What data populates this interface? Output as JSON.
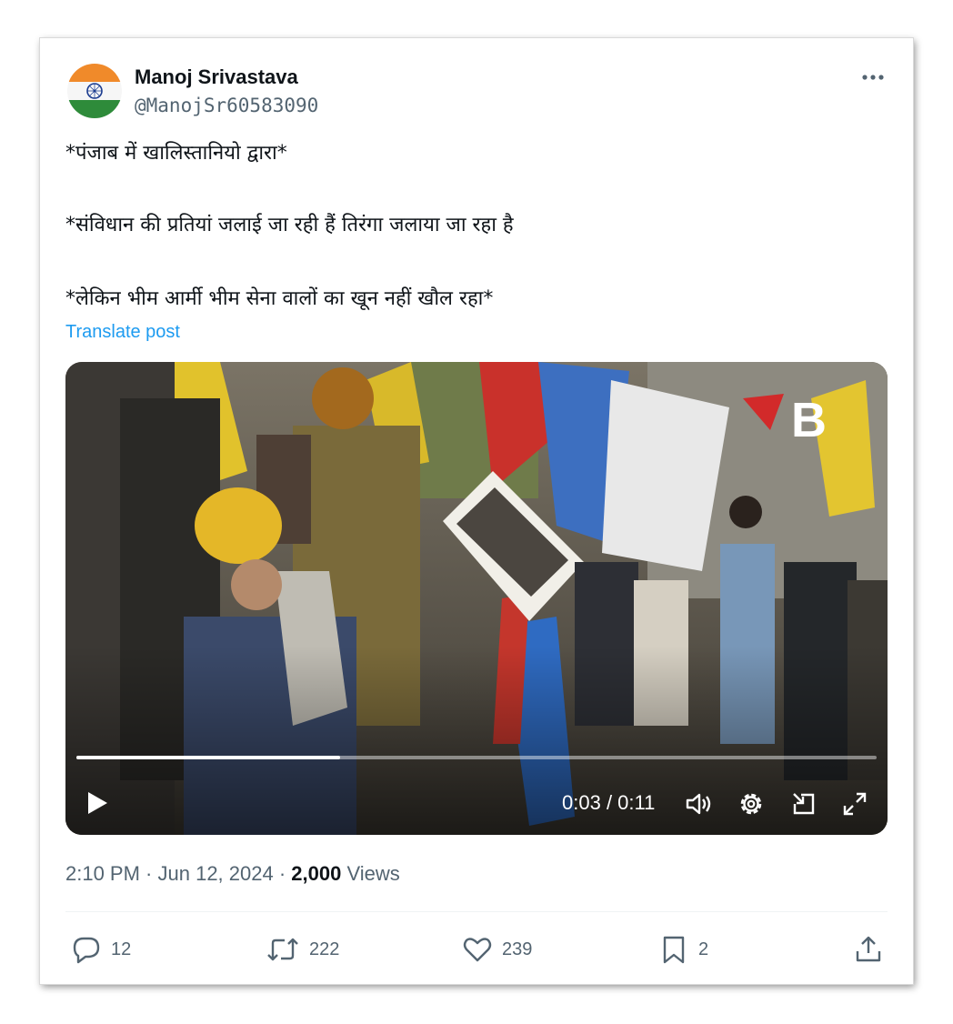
{
  "author": {
    "name": "Manoj Srivastava",
    "handle": "@ManojSr60583090"
  },
  "post": {
    "line1": "*पंजाब में खालिस्तानियो द्वारा*",
    "line2": "*संविधान की प्रतियां जलाई जा रही हैं तिरंगा जलाया जा रहा है",
    "line3": "*लेकिन भीम आर्मी भीम सेना वालों का खून नहीं खौल रहा*",
    "translate_label": "Translate post"
  },
  "video": {
    "current_time": "0:03",
    "separator": " / ",
    "duration": "0:11",
    "progress": 0.33
  },
  "meta": {
    "time": "2:10 PM",
    "date": "Jun 12, 2024",
    "dot": " · ",
    "views_count": "2,000",
    "views_label": " Views"
  },
  "actions": {
    "replies": "12",
    "reposts": "222",
    "likes": "239",
    "bookmarks": "2"
  },
  "colors": {
    "accent": "#1d9bf0",
    "secondary_text": "#536471"
  }
}
